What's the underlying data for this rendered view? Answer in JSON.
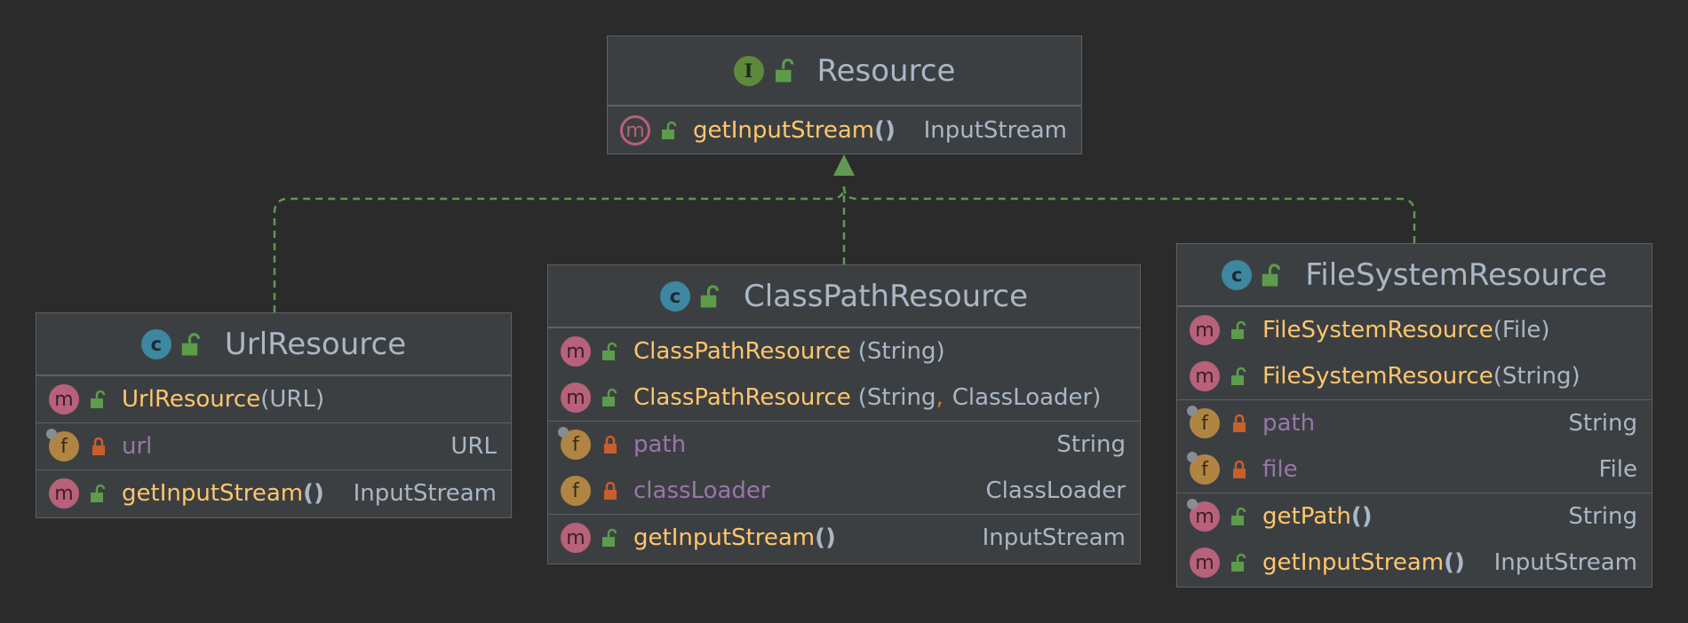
{
  "colors": {
    "background": "#2b2b2b",
    "box_fill": "#3c3f41",
    "box_border": "#5e6163",
    "arrow": "#629755",
    "method_name": "#ffc66d",
    "field_name": "#9876aa",
    "type_text": "#a9b7c6",
    "comma": "#cc7832"
  },
  "classes": {
    "resource": {
      "kind": "I",
      "name": "Resource",
      "methods": [
        {
          "name": "getInputStream",
          "parens": "()",
          "return_type": "InputStream"
        }
      ]
    },
    "url": {
      "kind": "c",
      "name": "UrlResource",
      "constructors": [
        {
          "name": "UrlResource",
          "open": "(",
          "params": "URL",
          "close": ")"
        }
      ],
      "fields": [
        {
          "name": "url",
          "type": "URL"
        }
      ],
      "methods": [
        {
          "name": "getInputStream",
          "parens": "()",
          "return_type": "InputStream"
        }
      ]
    },
    "classpath": {
      "kind": "c",
      "name": "ClassPathResource",
      "constructors": [
        {
          "name": "ClassPathResource",
          "open": "(",
          "params": "String",
          "close": ")"
        },
        {
          "name": "ClassPathResource",
          "open": "(",
          "param1": "String",
          "comma": ",",
          "param2": "ClassLoader",
          "close": ")"
        }
      ],
      "fields": [
        {
          "name": "path",
          "type": "String"
        },
        {
          "name": "classLoader",
          "type": "ClassLoader"
        }
      ],
      "methods": [
        {
          "name": "getInputStream",
          "parens": "()",
          "return_type": "InputStream"
        }
      ]
    },
    "filesystem": {
      "kind": "c",
      "name": "FileSystemResource",
      "constructors": [
        {
          "name": "FileSystemResource",
          "open": "(",
          "params": "File",
          "close": ")"
        },
        {
          "name": "FileSystemResource",
          "open": "(",
          "params": "String",
          "close": ")"
        }
      ],
      "fields": [
        {
          "name": "path",
          "type": "String"
        },
        {
          "name": "file",
          "type": "File"
        }
      ],
      "methods": [
        {
          "name": "getPath",
          "parens": "()",
          "return_type": "String"
        },
        {
          "name": "getInputStream",
          "parens": "()",
          "return_type": "InputStream"
        }
      ]
    }
  },
  "badges": {
    "method": "m",
    "field": "f"
  },
  "icons": {
    "public": "unlocked-padlock-icon",
    "private": "locked-padlock-icon",
    "final_field": "pin-icon",
    "implements": "hollow-triangle-arrow-icon"
  }
}
